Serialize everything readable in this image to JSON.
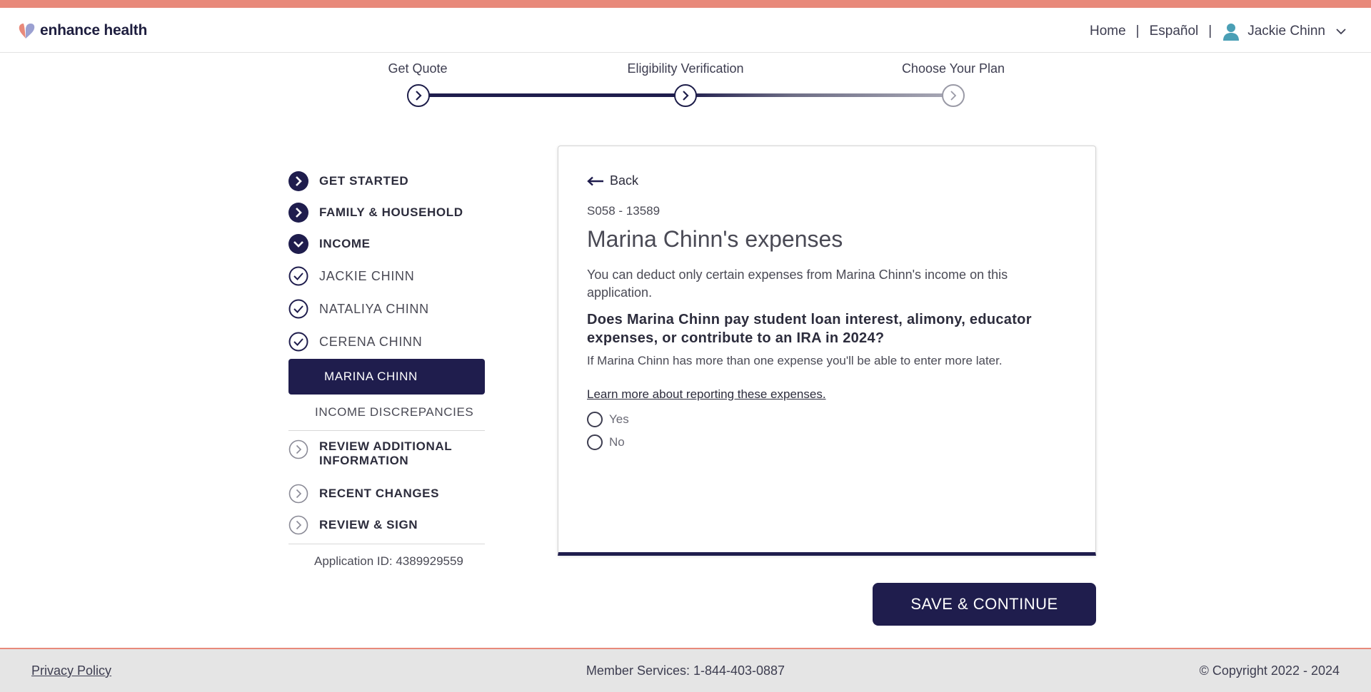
{
  "header": {
    "logo_text": "enhance health",
    "nav": {
      "home": "Home",
      "separator": "|",
      "language": "Español",
      "user_name": "Jackie Chinn"
    }
  },
  "stepper": {
    "steps": [
      {
        "label": "Get Quote",
        "state": "complete"
      },
      {
        "label": "Eligibility Verification",
        "state": "current"
      },
      {
        "label": "Choose Your Plan",
        "state": "upcoming"
      }
    ]
  },
  "sidebar": {
    "sections": [
      {
        "label": "GET STARTED",
        "icon": "chevron-right-filled-icon"
      },
      {
        "label": "FAMILY & HOUSEHOLD",
        "icon": "chevron-right-filled-icon"
      },
      {
        "label": "INCOME",
        "icon": "chevron-down-filled-icon"
      }
    ],
    "income_members": [
      {
        "label": "JACKIE CHINN",
        "icon": "check-circle-icon"
      },
      {
        "label": "NATALIYA CHINN",
        "icon": "check-circle-icon"
      },
      {
        "label": "CERENA CHINN",
        "icon": "check-circle-icon"
      }
    ],
    "active_item": "MARINA CHINN",
    "income_discrepancies": "INCOME DISCREPANCIES",
    "later_sections": [
      {
        "label": "REVIEW ADDITIONAL INFORMATION",
        "icon": "chevron-right-outline-icon"
      },
      {
        "label": "RECENT CHANGES",
        "icon": "chevron-right-outline-icon"
      },
      {
        "label": "REVIEW & SIGN",
        "icon": "chevron-right-outline-icon"
      }
    ],
    "application_id": "Application ID: 4389929559"
  },
  "card": {
    "back_label": "Back",
    "code": "S058 - 13589",
    "title": "Marina Chinn's expenses",
    "description": "You can deduct only certain expenses from Marina Chinn's income on this application.",
    "question": "Does Marina Chinn pay student loan interest, alimony, educator expenses, or contribute to an IRA in 2024?",
    "hint": "If Marina Chinn has more than one expense you'll be able to enter more later.",
    "learn_more": "Learn more about reporting these expenses.",
    "options": [
      {
        "label": "Yes",
        "selected": false
      },
      {
        "label": "No",
        "selected": false
      }
    ]
  },
  "actions": {
    "save_continue": "SAVE & CONTINUE"
  },
  "footer": {
    "privacy": "Privacy Policy",
    "member_services": "Member Services: 1-844-403-0887",
    "copyright": "© Copyright 2022 - 2024"
  },
  "colors": {
    "accent_coral": "#e8897a",
    "brand_navy": "#1f1d4d",
    "user_icon_teal": "#4a9fb5"
  }
}
